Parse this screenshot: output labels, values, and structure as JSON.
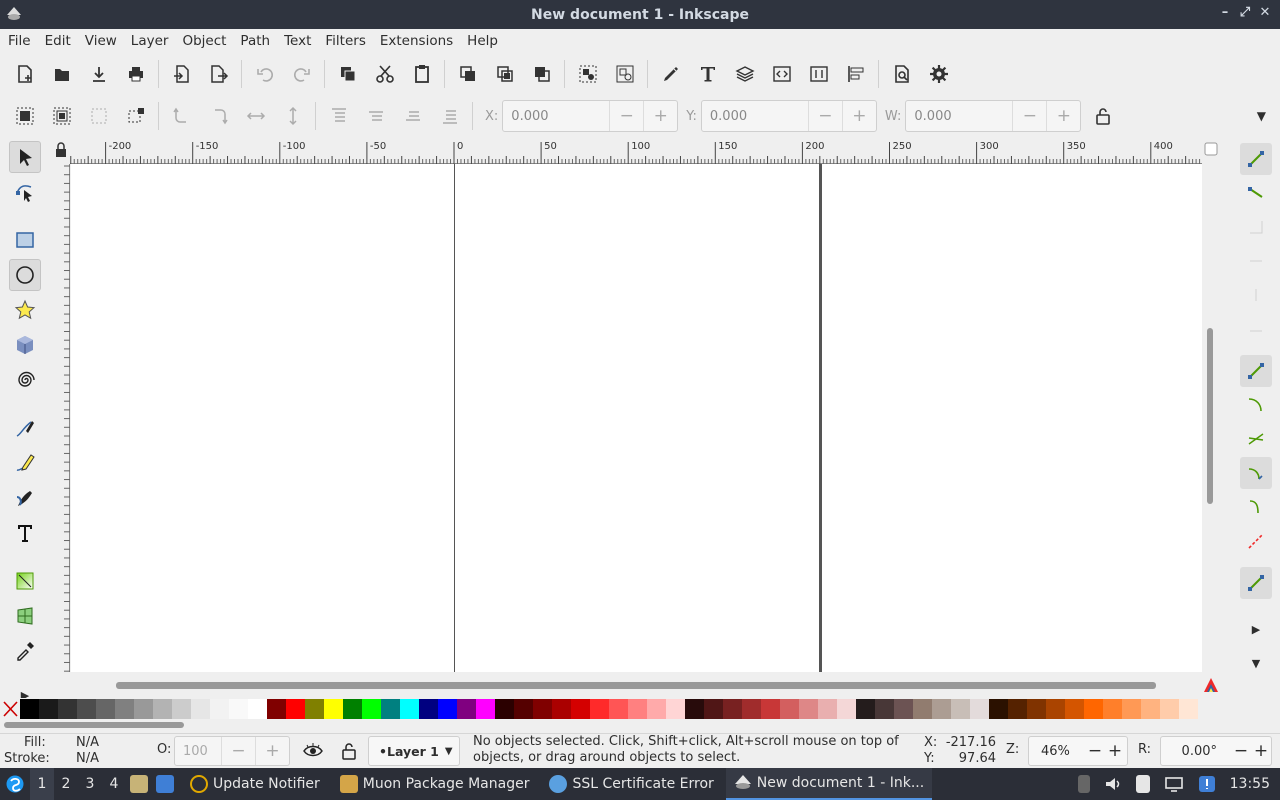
{
  "window": {
    "title": "New document 1 - Inkscape"
  },
  "menu": [
    "File",
    "Edit",
    "View",
    "Layer",
    "Object",
    "Path",
    "Text",
    "Filters",
    "Extensions",
    "Help"
  ],
  "toolctrl": {
    "x_label": "X:",
    "x_value": "0.000",
    "y_label": "Y:",
    "y_value": "0.000",
    "w_label": "W:",
    "w_value": "0.000"
  },
  "ruler": {
    "h_ticks": [
      "-200",
      "-150",
      "-100",
      "-50",
      "0",
      "50",
      "100",
      "150",
      "200",
      "250",
      "300",
      "350",
      "400"
    ]
  },
  "palette": {
    "colors": [
      "#000000",
      "#1a1a1a",
      "#333333",
      "#4d4d4d",
      "#666666",
      "#808080",
      "#999999",
      "#b3b3b3",
      "#cccccc",
      "#e6e6e6",
      "#f2f2f2",
      "#f9f9f9",
      "#ffffff",
      "#800000",
      "#ff0000",
      "#808000",
      "#ffff00",
      "#008000",
      "#00ff00",
      "#008080",
      "#00ffff",
      "#000080",
      "#0000ff",
      "#800080",
      "#ff00ff",
      "#2b0000",
      "#550000",
      "#800000",
      "#aa0000",
      "#d40000",
      "#ff2a2a",
      "#ff5555",
      "#ff8080",
      "#ffaaaa",
      "#ffd5d5",
      "#280b0b",
      "#501616",
      "#782121",
      "#a02c2c",
      "#c83737",
      "#d35f5f",
      "#de8787",
      "#e9afaf",
      "#f4d7d7",
      "#241c1c",
      "#483737",
      "#6c5353",
      "#917c6f",
      "#ac9d93",
      "#c8beb7",
      "#e3dbdb",
      "#2b1100",
      "#552200",
      "#803300",
      "#aa4400",
      "#d45500",
      "#ff6600",
      "#ff7f2a",
      "#ff9955",
      "#ffb380",
      "#ffccaa",
      "#ffe6d5"
    ]
  },
  "status": {
    "fill_label": "Fill:",
    "fill_value": "N/A",
    "stroke_label": "Stroke:",
    "stroke_value": "N/A",
    "opacity_label": "O:",
    "opacity_value": "100",
    "layer": "•Layer 1",
    "message": "No objects selected. Click, Shift+click, Alt+scroll mouse on top of objects, or drag around objects to select.",
    "x_label": "X:",
    "x_value": "-217.16",
    "y_label": "Y:",
    "y_value": "97.64",
    "zoom_label": "Z:",
    "zoom_value": "46%",
    "rotate_label": "R:",
    "rotate_value": "0.00°"
  },
  "taskbar": {
    "workspaces": [
      "1",
      "2",
      "3",
      "4"
    ],
    "tasks": [
      {
        "label": "Update Notifier",
        "color": "#e0a800"
      },
      {
        "label": "Muon Package Manager",
        "color": "#d4a548"
      },
      {
        "label": "SSL Certificate Error",
        "color": "#5aa0e0"
      },
      {
        "label": "New document 1 - Ink...",
        "color": "#e6e6e6"
      }
    ],
    "clock": "13:55"
  }
}
